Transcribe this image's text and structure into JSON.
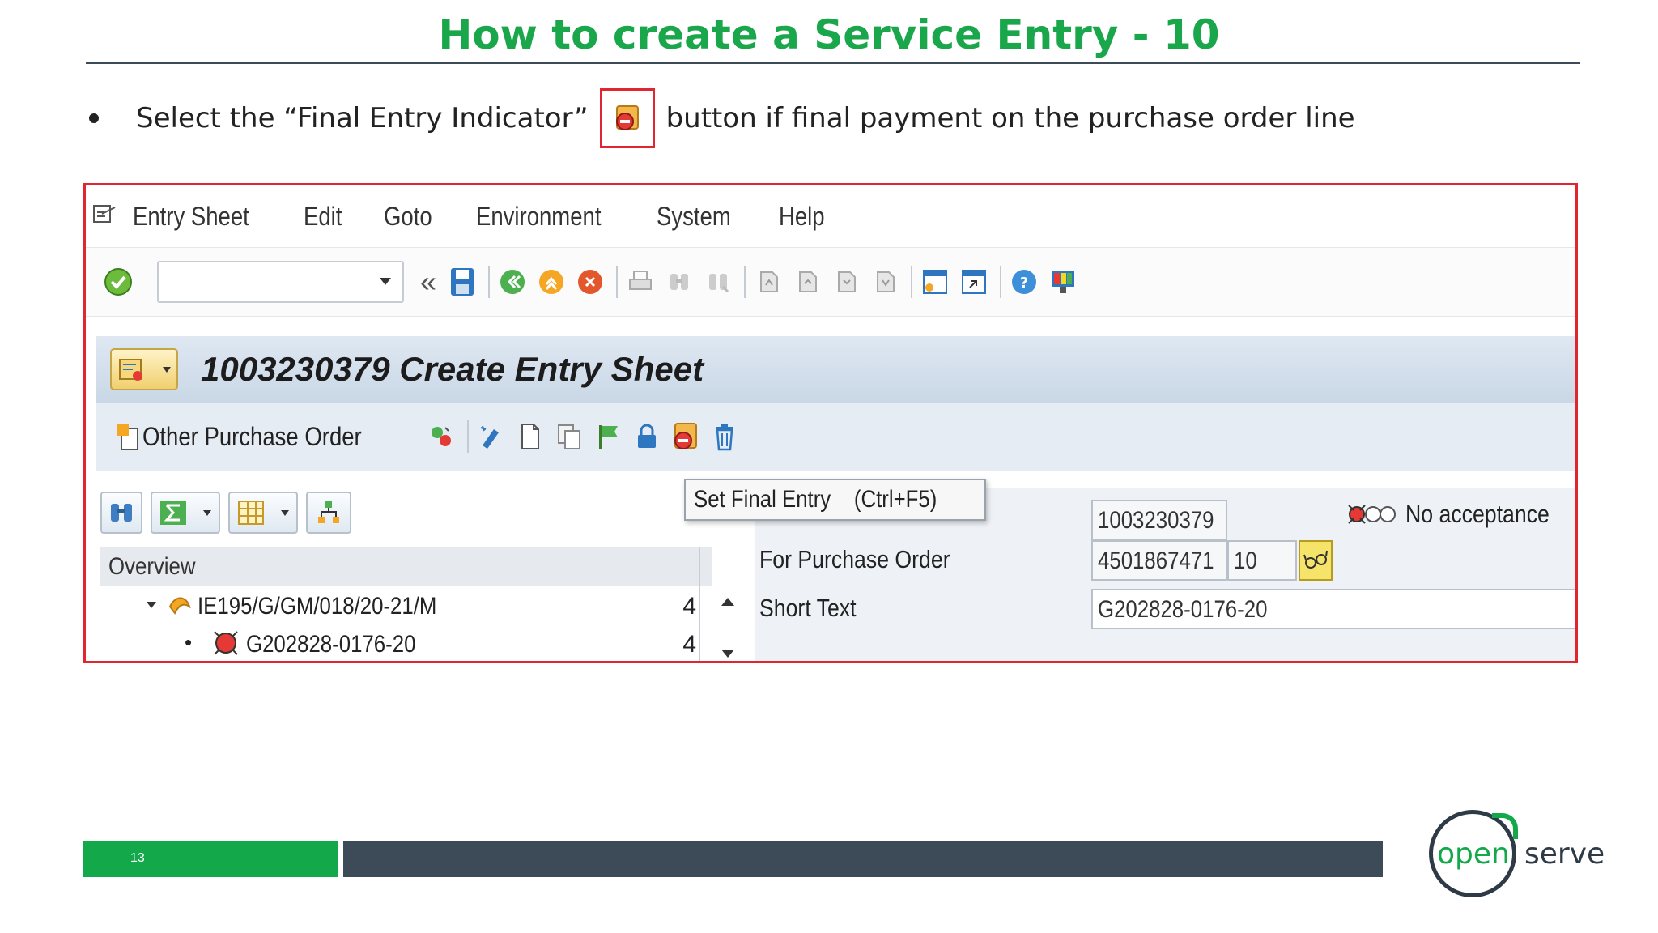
{
  "slide": {
    "title": "How to create a Service Entry - 10",
    "bullet_before": "Select the “Final Entry Indicator”",
    "bullet_after": "button if final payment on the purchase order line",
    "page_number": "13",
    "logo_left": "open",
    "logo_right": "serve"
  },
  "sap": {
    "menu": [
      "Entry Sheet",
      "Edit",
      "Goto",
      "Environment",
      "System",
      "Help"
    ],
    "command_field_value": "",
    "title": "1003230379 Create Entry Sheet",
    "app_toolbar": {
      "other_po_label": "Other Purchase Order"
    },
    "tooltip": "Set Final Entry    (Ctrl+F5)",
    "tooltip_underlying_label": "Entry Sheet",
    "overview": {
      "header": "Overview",
      "rows": [
        {
          "text": "IE195/G/GM/018/20-21/M",
          "count": "4"
        },
        {
          "text": "G202828-0176-20",
          "count": "4"
        }
      ]
    },
    "fields": {
      "entry_sheet_value": "1003230379",
      "acceptance_status": "No acceptance",
      "po_label": "For Purchase Order",
      "po_value": "4501867471",
      "po_item": "10",
      "short_text_label": "Short Text",
      "short_text_value": "G202828-0176-20"
    }
  },
  "colors": {
    "title_green": "#1aa64a",
    "highlight_red": "#e0262e",
    "footer_dark": "#3d4a57",
    "selection_yellow": "#fbd778"
  }
}
